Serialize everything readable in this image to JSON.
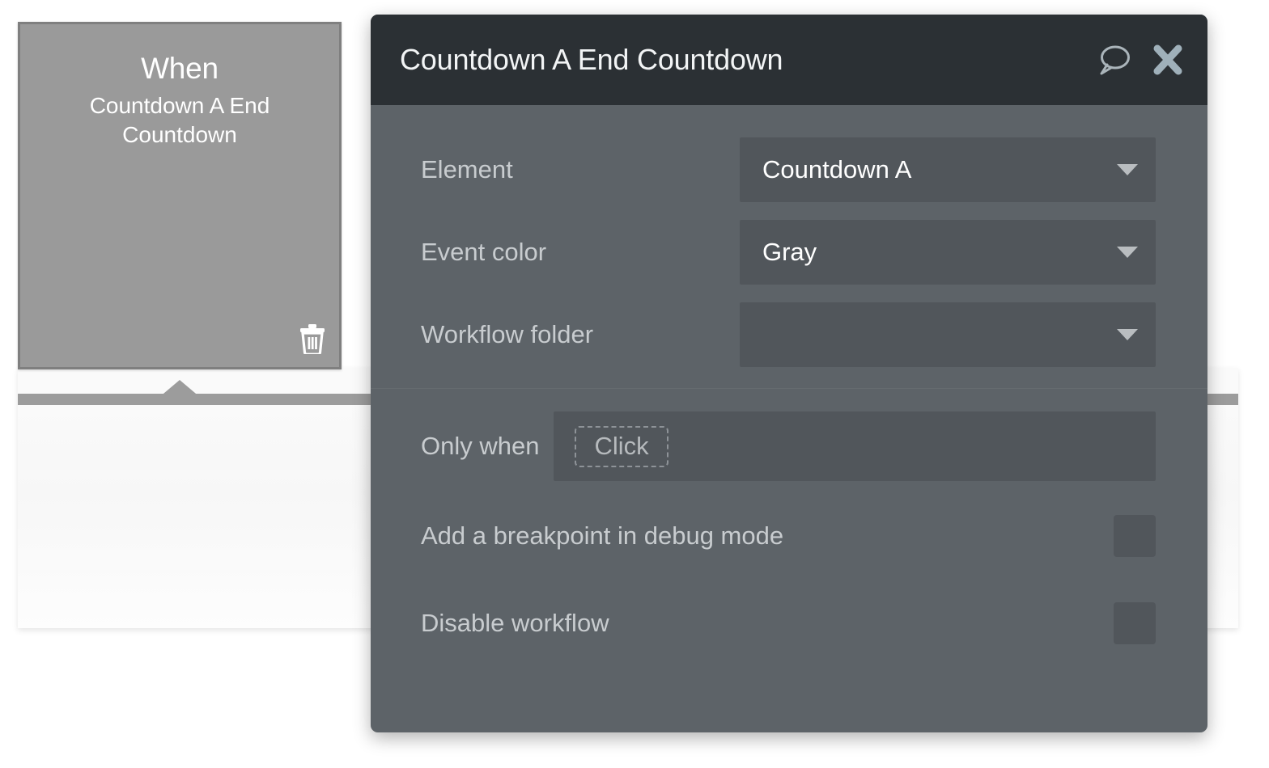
{
  "event_card": {
    "title": "When",
    "subtitle": "Countdown A End Countdown",
    "delete_icon": "trash-icon"
  },
  "panel": {
    "title": "Countdown A End Countdown",
    "comment_icon": "speech-bubble-icon",
    "close_icon": "close-icon",
    "fields": [
      {
        "label": "Element",
        "value": "Countdown A",
        "placeholder": "",
        "caret": "chevron-down-icon"
      },
      {
        "label": "Event color",
        "value": "Gray",
        "placeholder": "",
        "caret": "chevron-down-icon"
      },
      {
        "label": "Workflow folder",
        "value": "",
        "placeholder": "",
        "caret": "chevron-down-icon"
      }
    ],
    "only_when": {
      "label": "Only when",
      "chip_text": "Click"
    },
    "checkboxes": [
      {
        "label": "Add a breakpoint in debug mode",
        "checked": false
      },
      {
        "label": "Disable workflow",
        "checked": false
      }
    ]
  },
  "colors": {
    "panel_body": "#5d6368",
    "panel_header": "#2b3034",
    "field_bg": "#51565b",
    "card_gray": "#9a9a9a",
    "card_border": "#7f7f7f",
    "rail_gray": "#9c9c9c",
    "label_text": "#c8cccf",
    "value_text": "#ffffff"
  }
}
